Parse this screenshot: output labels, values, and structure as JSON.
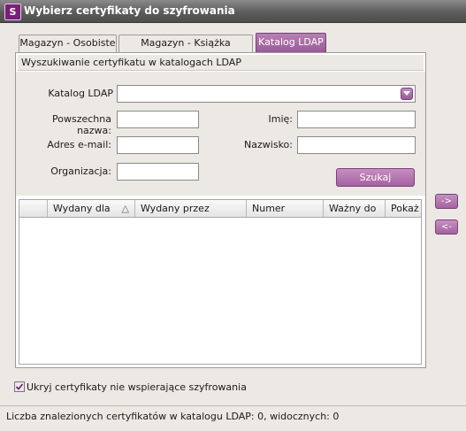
{
  "window": {
    "title": "Wybierz certyfikaty do szyfrowania",
    "icon": "app-logo-icon"
  },
  "tabs": [
    {
      "label": "Magazyn - Osobiste",
      "active": false
    },
    {
      "label": "Magazyn - Książka adresowa",
      "active": false
    },
    {
      "label": "Katalog LDAP",
      "active": true
    }
  ],
  "search": {
    "group_title": "Wyszukiwanie certyfikatu w katalogach LDAP",
    "catalog_label": "Katalog LDAP",
    "catalog_value": "",
    "common_name_label": "Powszechna nazwa:",
    "common_name_value": "",
    "email_label": "Adres e-mail:",
    "email_value": "",
    "organization_label": "Organizacja:",
    "organization_value": "",
    "first_name_label": "Imię:",
    "first_name_value": "",
    "last_name_label": "Nazwisko:",
    "last_name_value": "",
    "search_button": "Szukaj"
  },
  "table": {
    "columns": [
      "",
      "Wydany dla",
      "Wydany przez",
      "Numer seryjny",
      "Ważny do",
      "Pokaż"
    ],
    "sort_indicator": "△",
    "rows": []
  },
  "side_buttons": {
    "add": "->",
    "remove": "<-"
  },
  "hide_unsupported": {
    "label": "Ukryj certyfikaty nie wspierające szyfrowania",
    "checked": true
  },
  "status": {
    "text": "Liczba znalezionych certyfikatów w katalogu LDAP: 0, widocznych: 0"
  },
  "colors": {
    "accent": "#a562a0",
    "titlebar": "#5c5c5c"
  }
}
